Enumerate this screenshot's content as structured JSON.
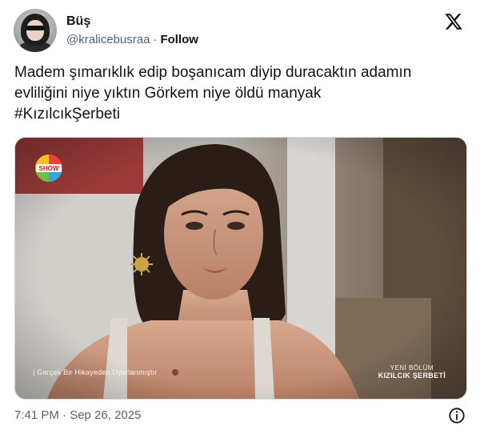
{
  "author": {
    "display_name": "Büş",
    "handle": "@kralicebusraa",
    "separator": "·",
    "follow_label": "Follow"
  },
  "tweet": {
    "lines": [
      "Madem şımarıklık edip boşanıcam diyip duracaktın adamın",
      "evliliğini niye yıktın Görkem niye öldü manyak",
      "#KızılcıkŞerbeti"
    ]
  },
  "media": {
    "channel_logo_text": "SHOW",
    "caption_left": "| Gerçek Bir Hikayeden Uyarlanmıştır",
    "caption_right_small": "YENİ BÖLÜM",
    "caption_right_big": "KIZILCIK ŞERBETİ"
  },
  "footer": {
    "timestamp": "7:41 PM · Sep 26, 2025"
  },
  "icons": {
    "x_logo": "x-logo-icon",
    "info": "info-icon"
  },
  "colors": {
    "text_primary": "#0f1419",
    "text_secondary": "#536471",
    "border": "#cfd9de"
  }
}
